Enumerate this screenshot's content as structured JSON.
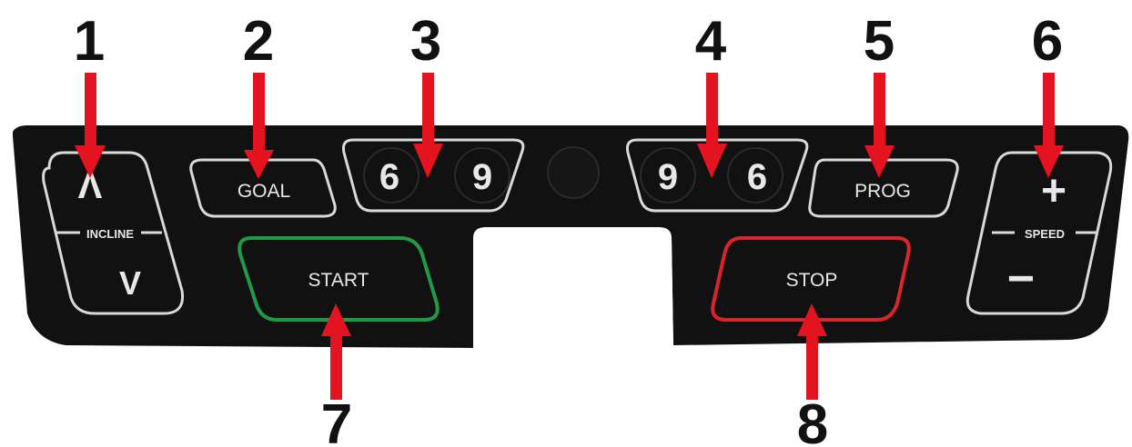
{
  "callouts": [
    "1",
    "2",
    "3",
    "4",
    "5",
    "6",
    "7",
    "8"
  ],
  "panel": {
    "incline": {
      "up": "Λ",
      "label": "INCLINE",
      "down": "V"
    },
    "goal": "GOAL",
    "quick_incline": [
      "6",
      "9"
    ],
    "quick_speed": [
      "9",
      "6"
    ],
    "prog": "PROG",
    "speed": {
      "plus": "+",
      "label": "SPEED",
      "minus": "−"
    },
    "start": "START",
    "stop": "STOP"
  },
  "colors": {
    "panel": "#111111",
    "outline": "#d9d9d9",
    "arrow": "#e3141f",
    "start": "#1f9a45",
    "stop": "#d8262d"
  }
}
